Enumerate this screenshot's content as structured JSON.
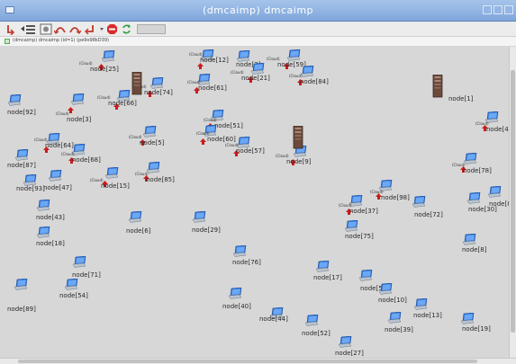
{
  "window": {
    "title": "(dmcaimp) dmcaimp"
  },
  "status": {
    "text": "(dmcaimp) dmcaimp (id=1) (pe9o98kD39)"
  },
  "toolbar": {
    "icons": [
      "back-icon",
      "list-icon",
      "settings-icon",
      "undo-icon",
      "redo-icon",
      "return-icon",
      "stop-icon",
      "refresh-icon",
      "field"
    ]
  },
  "colors": {
    "titlebar": "#8bb0e2",
    "canvas": "#d7d7d7",
    "laptop_screen": "#3f85e6",
    "cloud_flag": "#cc1b1b",
    "server": "#6b4a3a"
  },
  "topology": {
    "node_labels": [
      "node[25]",
      "node[12]",
      "node[2]",
      "node[59]",
      "node[21]",
      "node[84]",
      "node[74]",
      "node[66]",
      "node[61]",
      "node[92]",
      "node[3]",
      "node[51]",
      "node[60]",
      "node[5]",
      "node[57]",
      "node[9]",
      "node[41]",
      "node[64]",
      "node[68]",
      "node[87]",
      "node[47]",
      "node[93]",
      "node[15]",
      "node[85]",
      "node[78]",
      "node[98]",
      "node[37]",
      "node[72]",
      "node[30]",
      "node[80]",
      "node[43]",
      "node[6]",
      "node[29]",
      "node[75]",
      "node[18]",
      "node[8]",
      "node[76]",
      "node[71]",
      "node[17]",
      "node[50]",
      "node[54]",
      "node[10]",
      "node[89]",
      "node[40]",
      "node[13]",
      "node[44]",
      "node[39]",
      "node[52]",
      "node[19]",
      "node[27]",
      "node[1]"
    ],
    "cloud_label": "(Cloud)"
  }
}
